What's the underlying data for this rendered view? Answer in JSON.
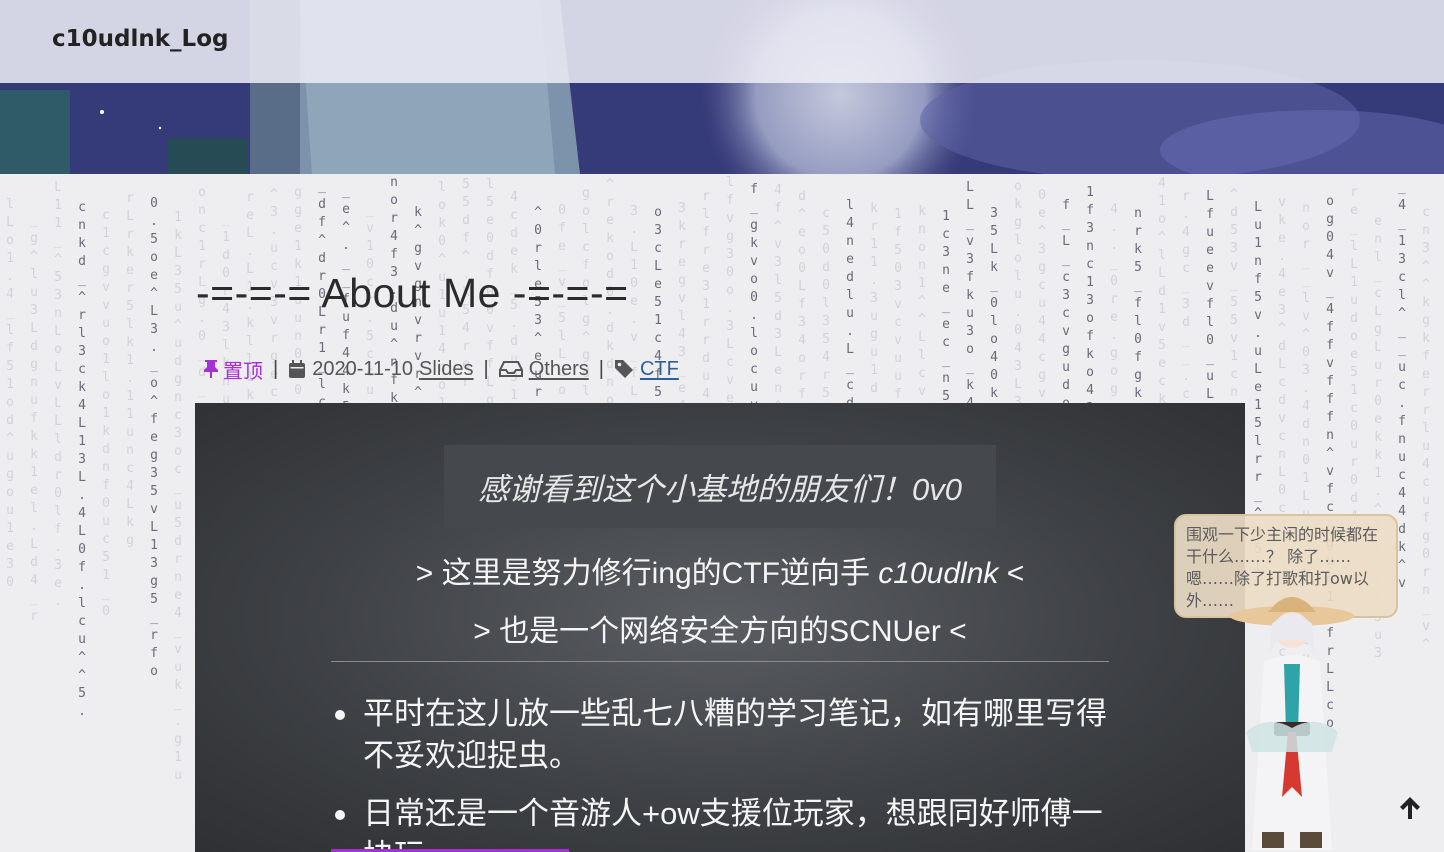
{
  "site": {
    "title": "c10udlnk_Log"
  },
  "post": {
    "title": "-=-=-= About Me -=-=-=",
    "pinned_label": "置顶",
    "date": "2020-11-10",
    "category_slides": "Slides",
    "category_others": "Others",
    "tag": "CTF"
  },
  "content": {
    "quote": "感谢看到这个小基地的朋友们！0v0",
    "line1_prefix": "> 这里是努力修行ing的CTF逆向手 ",
    "line1_name": "c10udlnk",
    "line1_suffix": " <",
    "line2": "> 也是一个网络安全方向的SCNUer <",
    "bullets": [
      "平时在这儿放一些乱七八糟的学习笔记，如有哪里写得不妥欢迎捉虫。",
      "日常还是一个音游人+ow支援位玩家，想跟同好师傅一块玩"
    ]
  },
  "mascot": {
    "bubble_text": "围观一下少主闲的时候都在干什么……？ 除了……嗯……除了打歌和打ow以外……"
  },
  "icons": [
    "pin-icon",
    "calendar-icon",
    "inbox-icon",
    "tag-icon",
    "arrow-up-icon"
  ],
  "colors": {
    "accent": "#a72fd6",
    "link": "#2f5f9b",
    "card": "#3e4145"
  }
}
